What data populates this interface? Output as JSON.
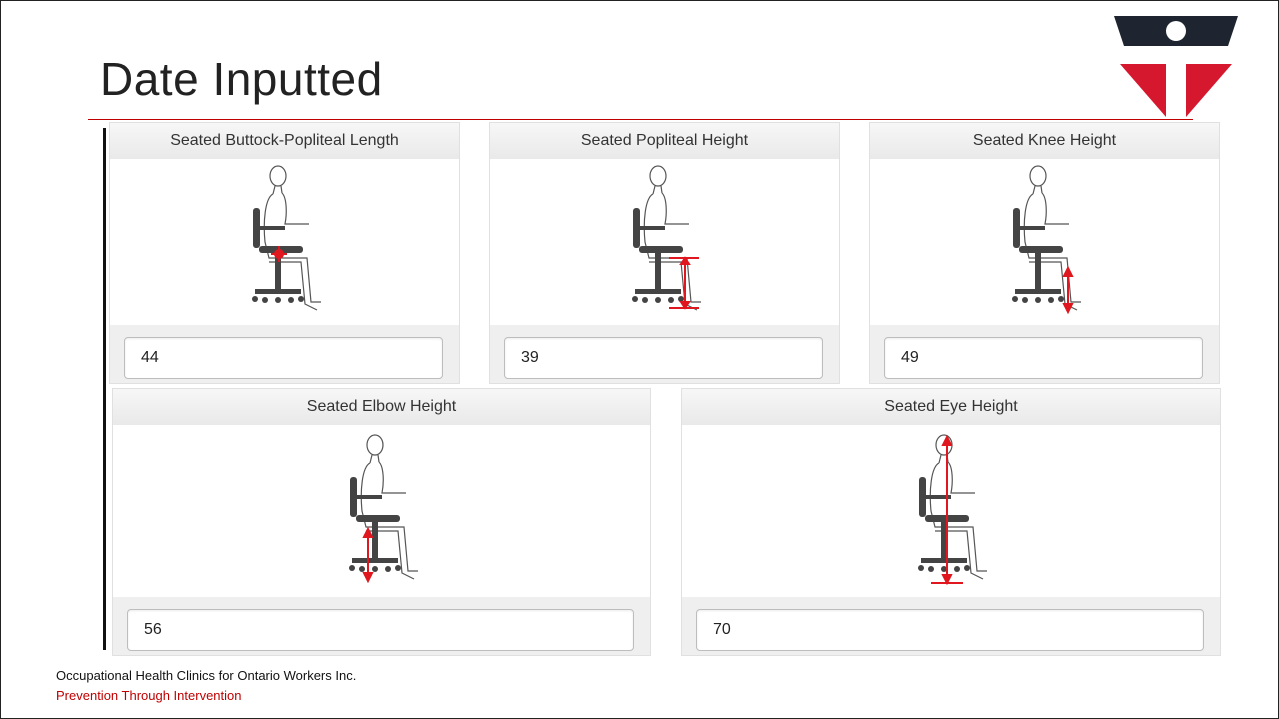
{
  "slide": {
    "title": "Date Inputted",
    "footer_org": "Occupational Health Clinics for Ontario Workers Inc.",
    "footer_tagline": "Prevention Through Intervention"
  },
  "colors": {
    "accent": "#c00000",
    "logo_dark": "#1e2530",
    "logo_red": "#d6182f",
    "indicator_red": "#e0171f"
  },
  "cards": [
    {
      "label": "Seated Buttock-Popliteal Length",
      "value": "44",
      "indicator": "buttock-popliteal-marker"
    },
    {
      "label": "Seated Popliteal Height",
      "value": "39",
      "indicator": "popliteal-height-arrow"
    },
    {
      "label": "Seated Knee Height",
      "value": "49",
      "indicator": "knee-height-arrow"
    },
    {
      "label": "Seated Elbow Height",
      "value": "56",
      "indicator": "elbow-height-arrow"
    },
    {
      "label": "Seated Eye Height",
      "value": "70",
      "indicator": "eye-height-arrow"
    }
  ]
}
